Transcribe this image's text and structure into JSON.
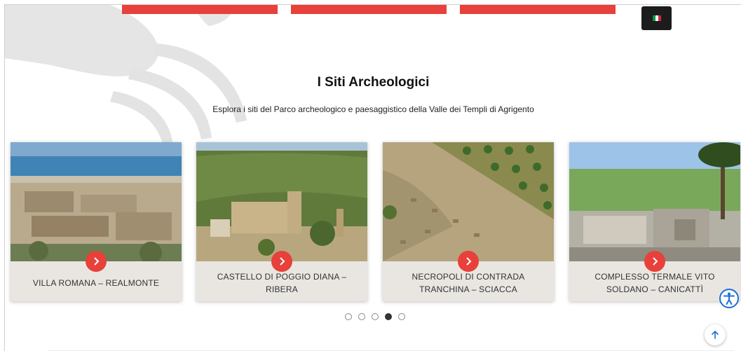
{
  "header": {
    "language_flag": "it-flag-icon",
    "accent_color": "#e8403a",
    "flag_colors": [
      "#009246",
      "#ffffff",
      "#ce2b37"
    ]
  },
  "section": {
    "title": "I Siti Archeologici",
    "subtitle": "Esplora i siti del Parco archeologico e paesaggistico della Valle dei Templi di Agrigento"
  },
  "cards": [
    {
      "title": "VILLA ROMANA – REALMONTE",
      "icon": "chevron-right-icon"
    },
    {
      "title": "CASTELLO DI POGGIO DIANA – RIBERA",
      "icon": "chevron-right-icon"
    },
    {
      "title": "NECROPOLI DI CONTRADA TRANCHINA – SCIACCA",
      "icon": "chevron-right-icon"
    },
    {
      "title": "COMPLESSO TERMALE VITO SOLDANO – CANICATTÌ",
      "icon": "chevron-right-icon"
    }
  ],
  "carousel": {
    "page_count": 5,
    "active_index": 3
  },
  "floating": {
    "accessibility_icon": "accessibility-icon",
    "scroll_top_icon": "arrow-up-icon"
  }
}
